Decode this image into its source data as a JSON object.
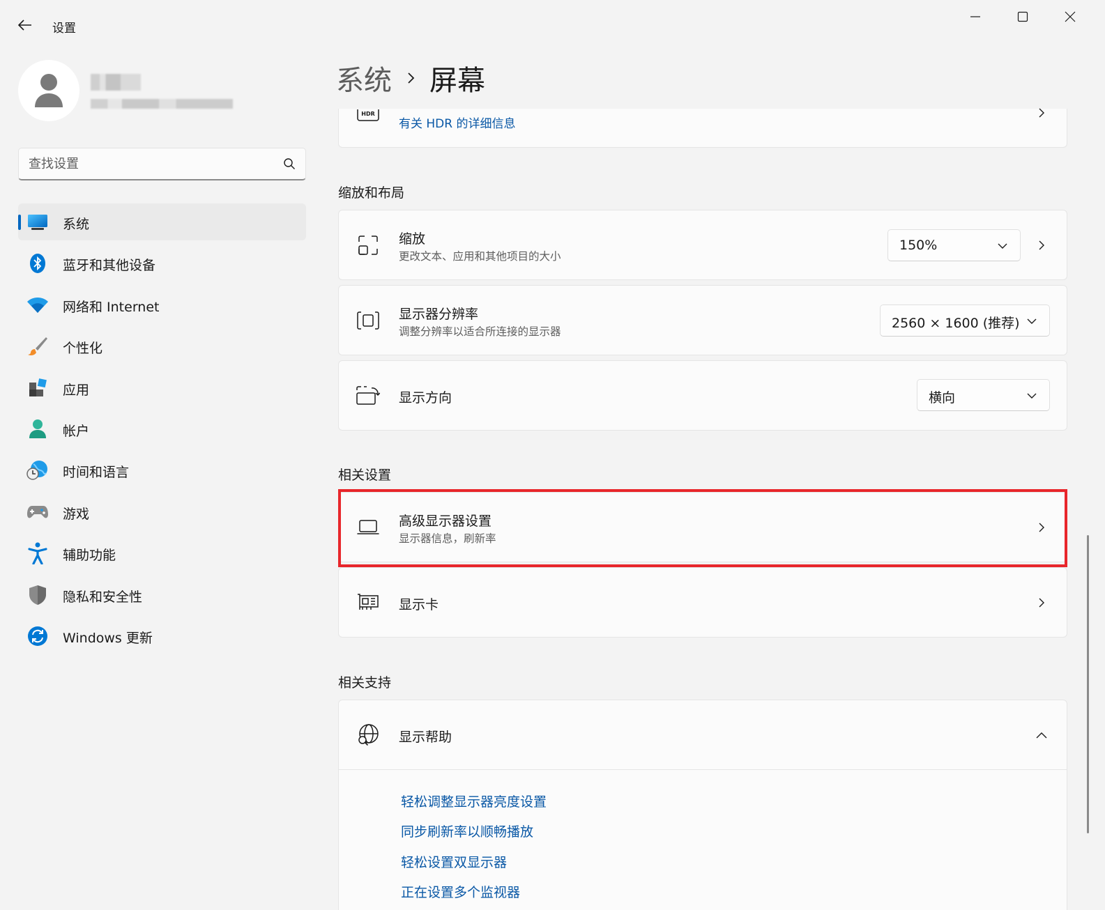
{
  "app": {
    "title": "设置"
  },
  "search": {
    "placeholder": "查找设置"
  },
  "sidebar": {
    "items": [
      {
        "label": "系统",
        "icon": "system-icon",
        "active": true
      },
      {
        "label": "蓝牙和其他设备",
        "icon": "bluetooth-icon"
      },
      {
        "label": "网络和 Internet",
        "icon": "wifi-icon"
      },
      {
        "label": "个性化",
        "icon": "brush-icon"
      },
      {
        "label": "应用",
        "icon": "apps-icon"
      },
      {
        "label": "帐户",
        "icon": "account-icon"
      },
      {
        "label": "时间和语言",
        "icon": "time-language-icon"
      },
      {
        "label": "游戏",
        "icon": "gamepad-icon"
      },
      {
        "label": "辅助功能",
        "icon": "accessibility-icon"
      },
      {
        "label": "隐私和安全性",
        "icon": "shield-icon"
      },
      {
        "label": "Windows 更新",
        "icon": "windows-update-icon"
      }
    ]
  },
  "breadcrumb": {
    "parent": "系统",
    "current": "屏幕"
  },
  "hdr": {
    "link": "有关 HDR 的详细信息",
    "icon": "hdr-icon"
  },
  "scale_layout": {
    "title": "缩放和布局",
    "scale": {
      "title": "缩放",
      "subtitle": "更改文本、应用和其他项目的大小",
      "value": "150%"
    },
    "resolution": {
      "title": "显示器分辨率",
      "subtitle": "调整分辨率以适合所连接的显示器",
      "value": "2560 × 1600 (推荐)"
    },
    "orientation": {
      "title": "显示方向",
      "value": "横向"
    }
  },
  "related_settings": {
    "title": "相关设置",
    "advanced": {
      "title": "高级显示器设置",
      "subtitle": "显示器信息，刷新率"
    },
    "graphics": {
      "title": "显示卡"
    }
  },
  "related_support": {
    "title": "相关支持",
    "help": {
      "title": "显示帮助"
    },
    "links": [
      "轻松调整显示器亮度设置",
      "同步刷新率以顺畅播放",
      "轻松设置双显示器",
      "正在设置多个监视器"
    ]
  },
  "colors": {
    "accent": "#0067c0",
    "link": "#0a58a6",
    "highlight": "#e8262b"
  }
}
